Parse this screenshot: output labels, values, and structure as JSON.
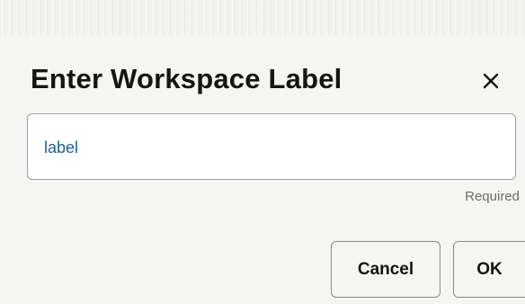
{
  "dialog": {
    "title": "Enter Workspace Label",
    "close_icon": "close-icon",
    "field": {
      "value": "label",
      "placeholder": "",
      "helper_text": "Required"
    },
    "buttons": {
      "cancel_label": "Cancel",
      "ok_label": "OK"
    }
  },
  "colors": {
    "background": "#f5f5f4",
    "title_text": "#161513",
    "input_text": "#1f5f8b",
    "field_border": "#9e9e9c",
    "button_border": "#8c8a86",
    "helper_text": "#6f6c68"
  }
}
